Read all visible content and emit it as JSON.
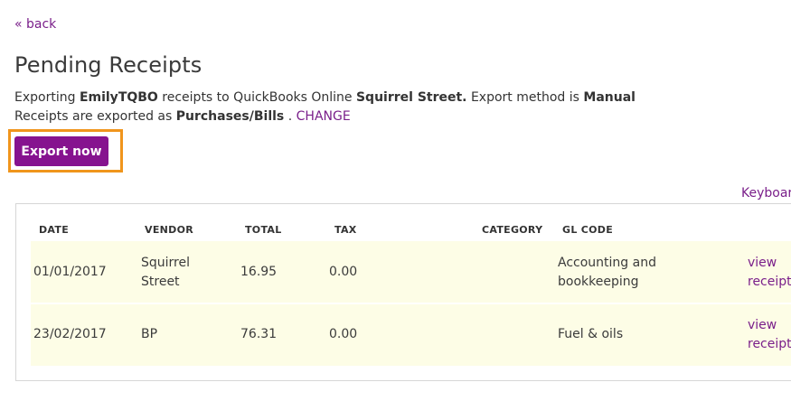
{
  "nav": {
    "back_label": "« back"
  },
  "page": {
    "title": "Pending Receipts"
  },
  "export_info": {
    "prefix": "Exporting ",
    "account": "EmilyTQBO",
    "middle": " receipts to QuickBooks Online ",
    "company": "Squirrel Street.",
    "method_prefix": " Export method is ",
    "method": "Manual",
    "type_prefix": "Receipts are exported as ",
    "type": "Purchases/Bills",
    "type_suffix": " . ",
    "change_label": "CHANGE"
  },
  "actions": {
    "export_now_label": "Export now"
  },
  "keyboard_link_label": "Keyboar",
  "table": {
    "columns": [
      "DATE",
      "VENDOR",
      "TOTAL",
      "TAX",
      "CATEGORY",
      "GL CODE"
    ],
    "rows": [
      {
        "date": "01/01/2017",
        "vendor_line1": "Squirrel",
        "vendor_line2": "Street",
        "total": "16.95",
        "tax": "0.00",
        "category": "",
        "gl_line1": "Accounting and",
        "gl_line2": "bookkeeping",
        "view_line1": "view",
        "view_line2": "receipt"
      },
      {
        "date": "23/02/2017",
        "vendor_line1": "BP",
        "vendor_line2": "",
        "total": "76.31",
        "tax": "0.00",
        "category": "",
        "gl_line1": "Fuel & oils",
        "gl_line2": "",
        "view_line1": "view",
        "view_line2": "receipt"
      }
    ]
  },
  "colors": {
    "accent": "#86138f",
    "link": "#7a1f8a",
    "highlight": "#f0951c",
    "row_bg": "#fdfde6"
  }
}
